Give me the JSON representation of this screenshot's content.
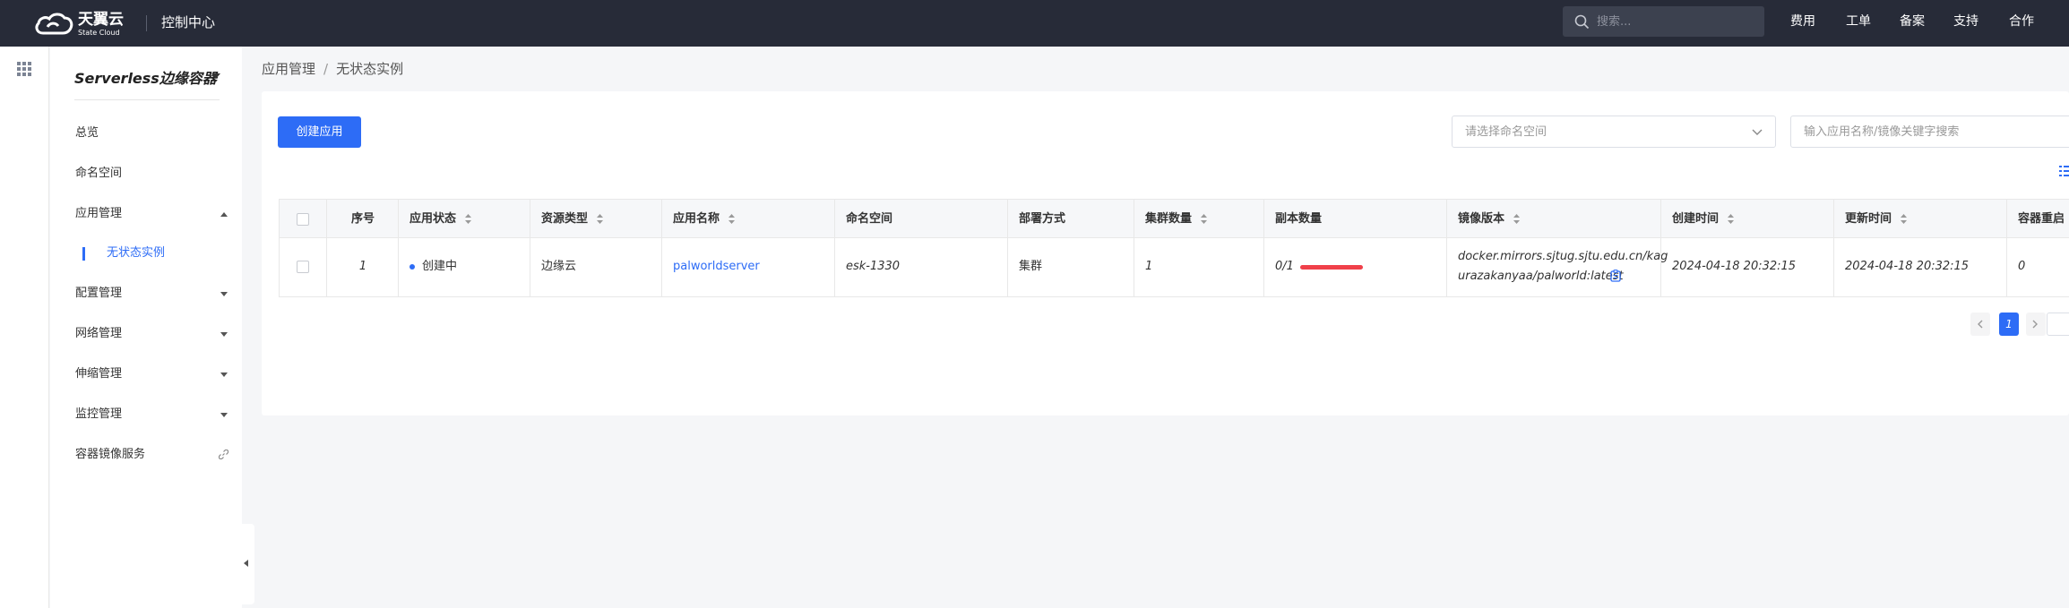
{
  "topbar": {
    "logo_cn": "天翼云",
    "logo_en": "State Cloud",
    "console_title": "控制中心",
    "search_placeholder": "搜索...",
    "nav": [
      "费用",
      "工单",
      "备案",
      "支持",
      "合作"
    ]
  },
  "sidebar": {
    "title": "Serverless边缘容器",
    "items": [
      {
        "label": "总览"
      },
      {
        "label": "命名空间"
      },
      {
        "label": "应用管理",
        "expanded": true
      },
      {
        "label": "无状态实例",
        "active": true
      },
      {
        "label": "配置管理"
      },
      {
        "label": "网络管理"
      },
      {
        "label": "伸缩管理"
      },
      {
        "label": "监控管理"
      },
      {
        "label": "容器镜像服务",
        "external": true
      }
    ]
  },
  "breadcrumb": {
    "parent": "应用管理",
    "separator": "/",
    "current": "无状态实例"
  },
  "toolbar": {
    "create_button": "创建应用",
    "namespace_placeholder": "请选择命名空间",
    "keyword_placeholder": "输入应用名称/镜像关键字搜索"
  },
  "table": {
    "headers": [
      "序号",
      "应用状态",
      "资源类型",
      "应用名称",
      "命名空间",
      "部署方式",
      "集群数量",
      "副本数量",
      "镜像版本",
      "创建时间",
      "更新时间",
      "容器重启"
    ],
    "rows": [
      {
        "index": "1",
        "status": "创建中",
        "resource_type": "边缘云",
        "app_name": "palworldserver",
        "namespace": "esk-1330",
        "deploy_mode": "集群",
        "cluster_count": "1",
        "replicas": "0/1",
        "replica_ready_fraction": 0,
        "image_line1": "docker.mirrors.sjtug.sjtu.edu.cn/kag",
        "image_line2": "urazakanyaa/palworld:latest",
        "created_at": "2024-04-18 20:32:15",
        "updated_at": "2024-04-18 20:32:15",
        "restarts": "0"
      }
    ]
  },
  "pagination": {
    "current_page": "1"
  },
  "colors": {
    "accent": "#2d6cf6",
    "topbar": "#272b38",
    "progress": "#f0404a"
  }
}
